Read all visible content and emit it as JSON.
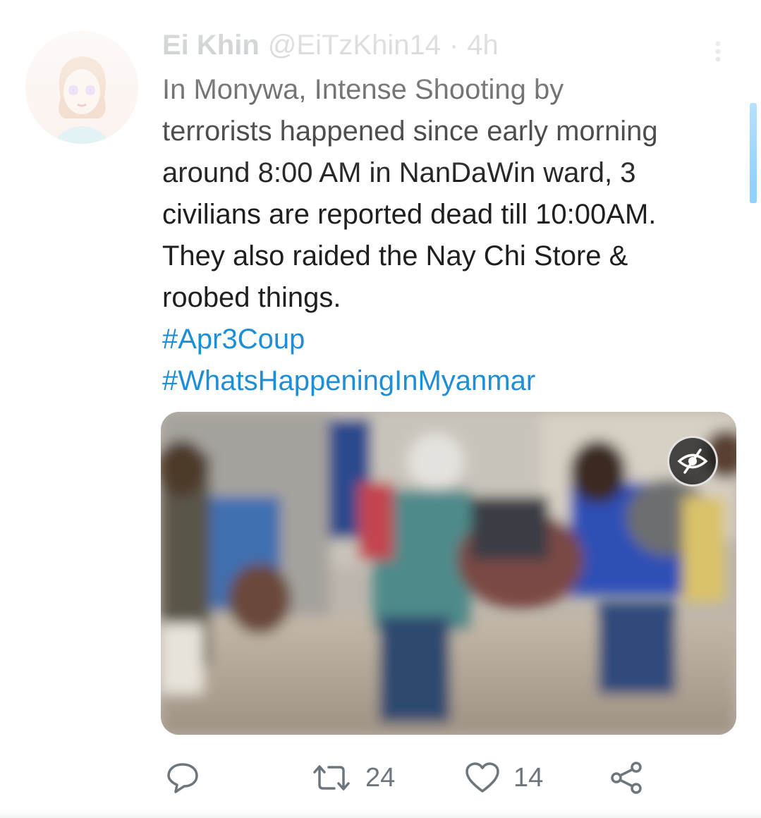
{
  "tweet": {
    "author_name": "Ei Khin",
    "author_handle": "@EiTzKhin14",
    "separator": "·",
    "time": "4h",
    "text_lines": [
      "In Monywa, Intense Shooting by",
      "terrorists happened since early morning",
      "around 8:00 AM in NanDaWin ward, 3",
      "civilians are reported dead till 10:00AM.",
      "They also raided the Nay Chi Store &",
      "roobed things."
    ],
    "hashtags": [
      "#Apr3Coup",
      "#WhatsHappeningInMyanmar"
    ],
    "media": {
      "sensitive_icon": "eye-slash-icon"
    },
    "actions": {
      "reply_icon": "reply-icon",
      "retweet_icon": "retweet-icon",
      "retweet_count": "24",
      "like_icon": "heart-icon",
      "like_count": "14",
      "share_icon": "share-icon"
    }
  },
  "colors": {
    "hashtag": "#1e8fd6",
    "text": "#1f1f1f",
    "muted": "#6e767d",
    "scroll_indicator": "#6ec1ff"
  }
}
